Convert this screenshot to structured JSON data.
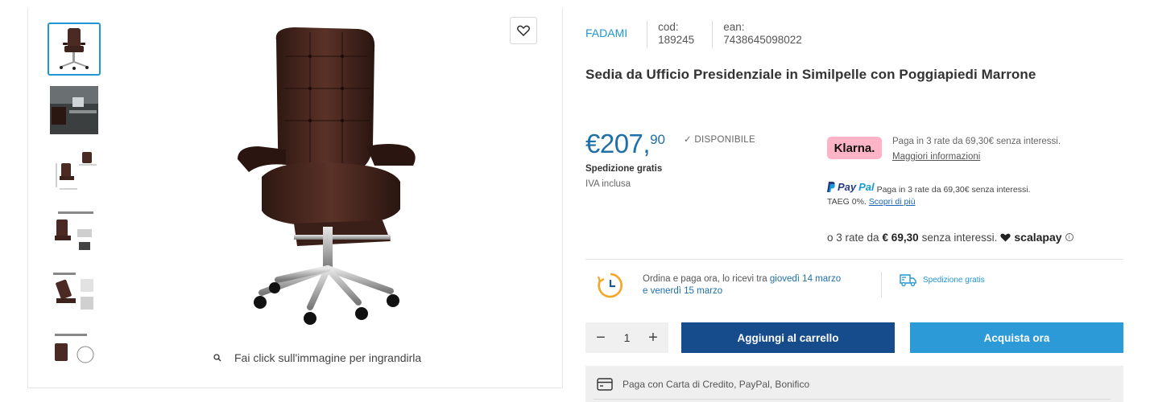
{
  "gallery": {
    "thumbnails": [
      {
        "name": "thumbnail-1",
        "selected": true
      },
      {
        "name": "thumbnail-2",
        "selected": false
      },
      {
        "name": "thumbnail-3",
        "selected": false
      },
      {
        "name": "thumbnail-4",
        "selected": false
      },
      {
        "name": "thumbnail-5",
        "selected": false
      },
      {
        "name": "thumbnail-6",
        "selected": false
      }
    ],
    "zoom_hint": "Fai click sull'immagine per ingrandirla",
    "wishlist_icon": "heart-icon"
  },
  "product": {
    "brand": "FADAMI",
    "code_label": "cod:",
    "code_value": "189245",
    "ean_label": "ean:",
    "ean_value": "7438645098022",
    "title": "Sedia da Ufficio Presidenziale in Similpelle con Poggiapiedi Marrone",
    "price_main": "€207,",
    "price_cents": "90",
    "availability": "✓ DISPONIBILE",
    "shipping": "Spedizione gratis",
    "vat": "IVA inclusa"
  },
  "klarna": {
    "badge": "Klarna.",
    "text": "Paga in 3 rate da 69,30€ senza interessi.",
    "link": "Maggiori informazioni"
  },
  "paypal": {
    "logo_pay": "Pay",
    "logo_pal": "Pal",
    "text": "Paga in 3 rate da 69,30€ senza interessi.",
    "taeg": "TAEG 0%.",
    "link": "Scopri di più"
  },
  "scalapay": {
    "prefix": "o 3 rate da",
    "amount": "€ 69,30",
    "suffix": "senza interessi.",
    "logo": "scalapay"
  },
  "delivery": {
    "text_prefix": "Ordina e paga ora, lo ricevi tra",
    "date_start": "giovedì 14 marzo",
    "conj": "e",
    "date_end": "venerdì 15 marzo",
    "shipping_badge": "Spedizione gratis"
  },
  "cart": {
    "quantity": "1",
    "minus": "−",
    "plus": "+",
    "add_to_cart": "Aggiungi al carrello",
    "buy_now": "Acquista ora"
  },
  "payment_methods": "Paga con Carta di Credito, PayPal, Bonifico",
  "colors": {
    "accent": "#2196d3",
    "cart_button": "#174c8c",
    "buy_button": "#2b9ad7",
    "price": "#1f6fa8",
    "klarna": "#ffb3c7",
    "delivery_icon": "#f5a623"
  }
}
